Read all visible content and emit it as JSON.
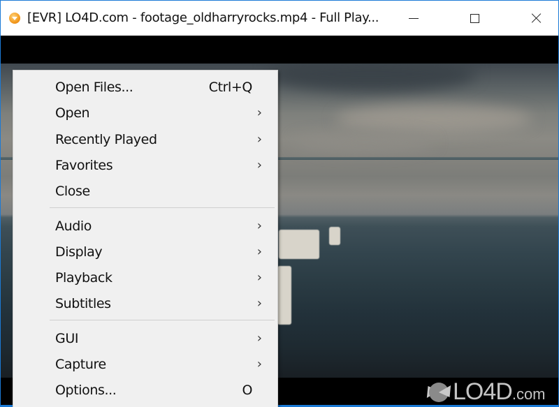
{
  "window": {
    "title": "[EVR] LO4D.com - footage_oldharryrocks.mp4 - Full Play...",
    "controls": {
      "minimize": "minimize",
      "maximize": "maximize",
      "close": "close"
    }
  },
  "menu": {
    "groups": [
      [
        {
          "label": "Open Files...",
          "shortcut": "Ctrl+Q",
          "submenu": false
        },
        {
          "label": "Open",
          "shortcut": "",
          "submenu": true
        },
        {
          "label": "Recently Played",
          "shortcut": "",
          "submenu": true
        },
        {
          "label": "Favorites",
          "shortcut": "",
          "submenu": true
        },
        {
          "label": "Close",
          "shortcut": "",
          "submenu": false
        }
      ],
      [
        {
          "label": "Audio",
          "shortcut": "",
          "submenu": true
        },
        {
          "label": "Display",
          "shortcut": "",
          "submenu": true
        },
        {
          "label": "Playback",
          "shortcut": "",
          "submenu": true
        },
        {
          "label": "Subtitles",
          "shortcut": "",
          "submenu": true
        }
      ],
      [
        {
          "label": "GUI",
          "shortcut": "",
          "submenu": true
        },
        {
          "label": "Capture",
          "shortcut": "",
          "submenu": true
        },
        {
          "label": "Options...",
          "shortcut": "O",
          "submenu": false
        }
      ]
    ],
    "submenu_arrow": "›"
  },
  "watermark": {
    "text": "LO4D",
    "suffix": ".com"
  },
  "colors": {
    "accent_border": "#1b7ad6",
    "menu_bg": "#f0f0f0"
  }
}
